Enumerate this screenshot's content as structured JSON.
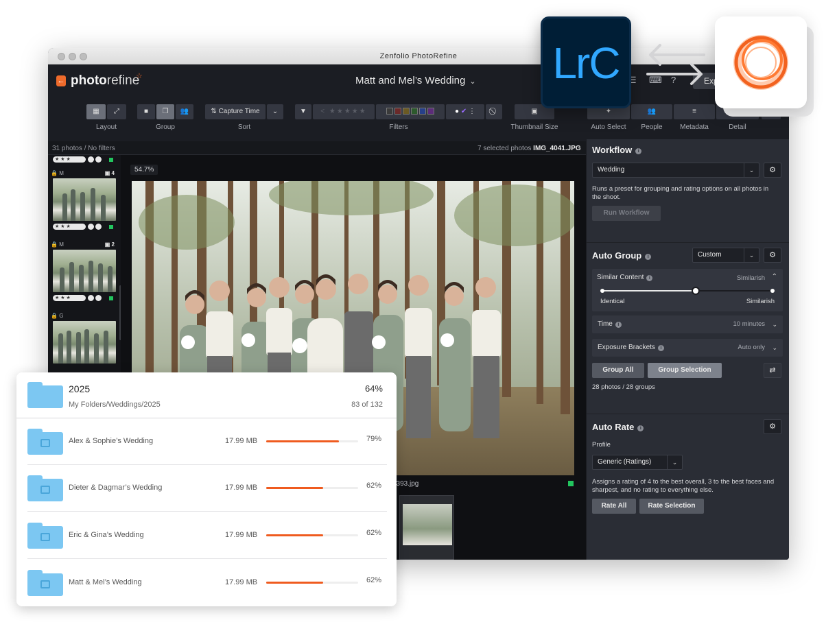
{
  "window": {
    "title": "Zenfolio PhotoRefine"
  },
  "app": {
    "logo": {
      "bold": "photo",
      "light": "refine",
      "star": "☆"
    },
    "shoot_title": "Matt and Mel’s Wedding",
    "export_label": "Exp"
  },
  "toolbar": {
    "layout_label": "Layout",
    "group_label": "Group",
    "sort_label": "Sort",
    "sort_value": "Capture Time",
    "filters_label": "Filters",
    "thumbnail_label": "Thumbnail Size",
    "auto_select_label": "Auto Select",
    "people_label": "People",
    "metadata_label": "Metadata",
    "detail_label": "Detail"
  },
  "strip": {
    "left": "31 photos / No filters",
    "right_prefix": "7 selected photos",
    "right_file": "IMG_4041.JPG"
  },
  "filmstrip": [
    {
      "tag": "M",
      "count": "4",
      "rating": "★ ★ ★"
    },
    {
      "tag": "M",
      "count": "2",
      "rating": "★ ★ ★"
    },
    {
      "tag": "G",
      "count": "",
      "rating": ""
    }
  ],
  "filmstrip_top_rating": "★ ★ ★",
  "viewer": {
    "zoom": "54.7%",
    "filename": "5393.jpg"
  },
  "panel": {
    "workflow": {
      "title": "Workflow",
      "preset": "Wedding",
      "description": "Runs a preset for grouping and rating options on all photos in the shoot.",
      "run_label": "Run Workflow"
    },
    "auto_group": {
      "title": "Auto Group",
      "preset": "Custom",
      "similar_content": {
        "label": "Similar Content",
        "value": "Similarish",
        "min_label": "Identical",
        "max_label": "Similarish",
        "level": 0.55
      },
      "time": {
        "label": "Time",
        "value": "10 minutes"
      },
      "exposure": {
        "label": "Exposure Brackets",
        "value": "Auto only"
      },
      "group_all_label": "Group All",
      "group_selection_label": "Group Selection",
      "summary": "28 photos / 28 groups"
    },
    "auto_rate": {
      "title": "Auto Rate",
      "profile_label": "Profile",
      "profile_value": "Generic (Ratings)",
      "description": "Assigns a rating of 4 to the best overall, 3 to the best faces and sharpest, and no rating to everything else.",
      "rate_all_label": "Rate All",
      "rate_selection_label": "Rate Selection"
    }
  },
  "badges": {
    "lrc": "LrC"
  },
  "folder_card": {
    "title": "2025",
    "path": "My Folders/Weddings/2025",
    "percent": "64%",
    "progress": "83 of 132",
    "rows": [
      {
        "name": "Alex & Sophie’s Wedding",
        "size": "17.99 MB",
        "percent": "79%",
        "value": 0.79
      },
      {
        "name": "Dieter & Dagmar’s Wedding",
        "size": "17.99 MB",
        "percent": "62%",
        "value": 0.62
      },
      {
        "name": "Eric & Gina’s Wedding",
        "size": "17.99 MB",
        "percent": "62%",
        "value": 0.62
      },
      {
        "name": "Matt & Mel’s Wedding",
        "size": "17.99 MB",
        "percent": "62%",
        "value": 0.62
      }
    ]
  },
  "colors": {
    "accent": "#ee6a2b",
    "progress": "#ef5b1f",
    "folder": "#7cc7f2",
    "lrc_bg": "#001e36",
    "lrc_text": "#31a8ff",
    "panel_bg": "#2a2d35"
  }
}
